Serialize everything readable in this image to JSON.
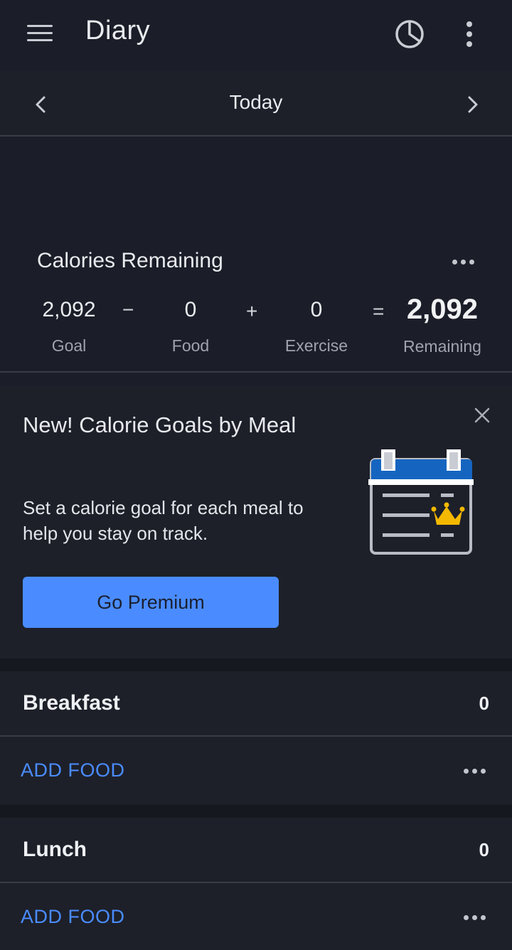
{
  "header": {
    "title": "Diary"
  },
  "date_nav": {
    "label": "Today"
  },
  "calories": {
    "title": "Calories Remaining",
    "goal": {
      "value": "2,092",
      "label": "Goal"
    },
    "food": {
      "value": "0",
      "label": "Food"
    },
    "exercise": {
      "value": "0",
      "label": "Exercise"
    },
    "remaining": {
      "value": "2,092",
      "label": "Remaining"
    },
    "ops": {
      "minus": "−",
      "plus": "+",
      "equals": "="
    }
  },
  "promo": {
    "title": "New! Calorie Goals by Meal",
    "body": "Set a calorie goal for each meal to help you stay on track.",
    "button": "Go Premium"
  },
  "meals": [
    {
      "name": "Breakfast",
      "calories": "0",
      "add_label": "ADD FOOD"
    },
    {
      "name": "Lunch",
      "calories": "0",
      "add_label": "ADD FOOD"
    }
  ],
  "colors": {
    "accent": "#4a8cff",
    "background": "#1b1e28",
    "crown": "#f5b800",
    "calendar_header": "#1565c0"
  },
  "icons": [
    "menu-icon",
    "pie-chart-icon",
    "more-vertical-icon",
    "chevron-left-icon",
    "chevron-right-icon",
    "more-horizontal-icon",
    "close-icon",
    "calendar-crown-icon"
  ]
}
